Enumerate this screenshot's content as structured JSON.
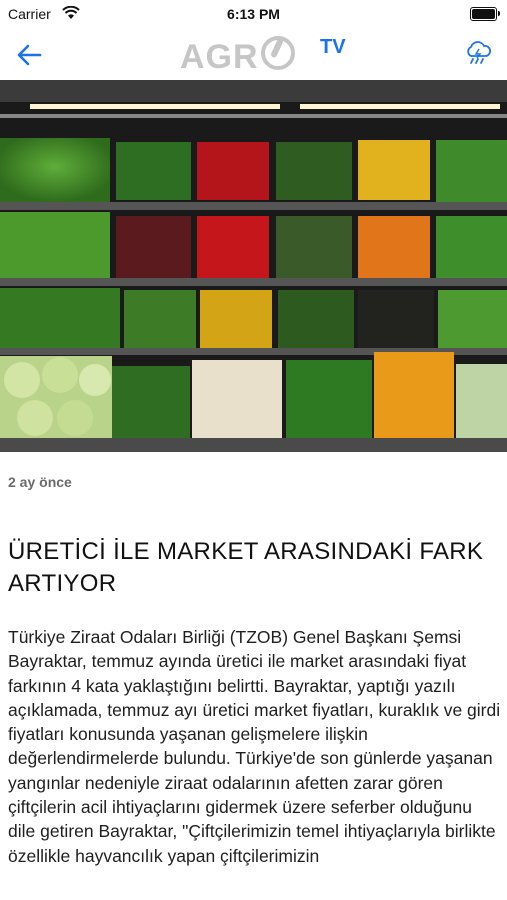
{
  "status_bar": {
    "carrier": "Carrier",
    "time": "6:13 PM",
    "icons": [
      "wifi-icon",
      "battery-icon"
    ]
  },
  "nav": {
    "logo_text": "AGR",
    "logo_badge": "TV",
    "back_icon": "arrow-left-icon",
    "weather_icon": "cloud-rain-icon",
    "accent": "#1a73e8"
  },
  "article": {
    "hero_image": "vegetable-market-shelves",
    "published": "2 ay önce",
    "title": "ÜRETİCİ İLE MARKET ARASINDAKİ FARK ARTIYOR",
    "body": "Türkiye Ziraat Odaları Birliği (TZOB) Genel Başkanı Şemsi Bayraktar, temmuz ayında üretici ile market arasındaki fiyat farkının 4 kata yaklaştığını belirtti. Bayraktar, yaptığı yazılı açıklamada, temmuz ayı üretici market fiyatları, kuraklık ve girdi fiyatları konusunda yaşanan gelişmelere ilişkin değerlendirmelerde bulundu. Türkiye'de son günlerde yaşanan yangınlar nedeniyle ziraat odalarının afetten zarar gören çiftçilerin acil ihtiyaçlarını gidermek üzere seferber olduğunu dile getiren Bayraktar, \"Çiftçilerimizin temel ihtiyaçlarıyla birlikte özellikle hayvancılık yapan çiftçilerimizin"
  }
}
